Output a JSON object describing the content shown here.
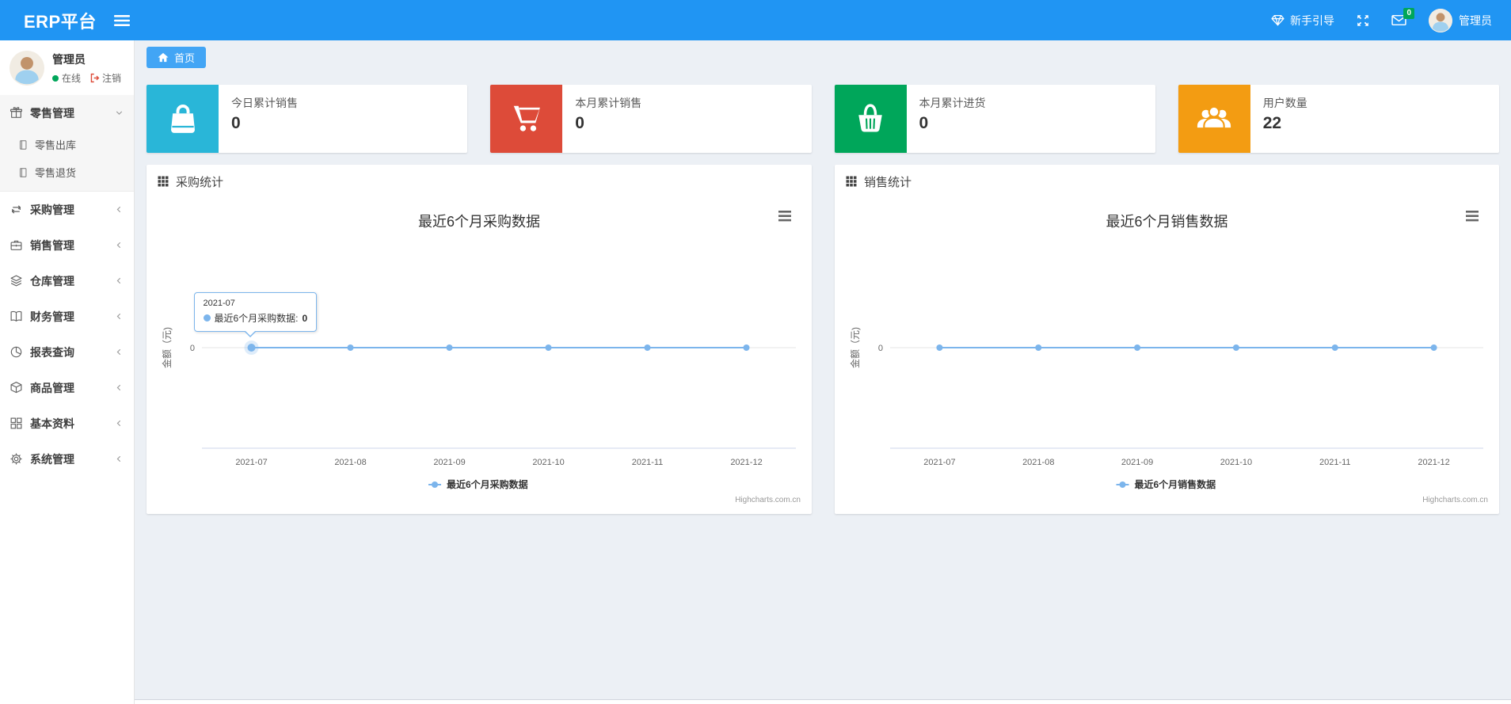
{
  "navbar": {
    "brand": "ERP平台",
    "guide_label": "新手引导",
    "mail_badge": "0",
    "username": "管理员",
    "badge_color": "#00a65a",
    "bg_color": "#2095f3"
  },
  "sidebar": {
    "user": {
      "name": "管理员",
      "status_label": "在线",
      "logout_label": "注销"
    },
    "items": [
      {
        "label": "零售管理",
        "icon": "gift-icon",
        "expanded": true,
        "children": [
          {
            "label": "零售出库",
            "icon": "notebook-icon"
          },
          {
            "label": "零售退货",
            "icon": "notebook-icon"
          }
        ]
      },
      {
        "label": "采购管理",
        "icon": "repeat-icon"
      },
      {
        "label": "销售管理",
        "icon": "briefcase-icon"
      },
      {
        "label": "仓库管理",
        "icon": "layers-icon"
      },
      {
        "label": "财务管理",
        "icon": "open-book-icon"
      },
      {
        "label": "报表查询",
        "icon": "pie-chart-icon"
      },
      {
        "label": "商品管理",
        "icon": "cube-icon"
      },
      {
        "label": "基本资料",
        "icon": "grid-icon"
      },
      {
        "label": "系统管理",
        "icon": "gear-icon"
      }
    ]
  },
  "breadcrumb": {
    "home_label": "首页"
  },
  "stat_cards": [
    {
      "label": "今日累计销售",
      "value": "0",
      "color": "#29b6d8",
      "icon": "shopping-bag-icon"
    },
    {
      "label": "本月累计销售",
      "value": "0",
      "color": "#dd4b39",
      "icon": "shopping-cart-icon"
    },
    {
      "label": "本月累计进货",
      "value": "0",
      "color": "#00a65a",
      "icon": "shopping-basket-icon"
    },
    {
      "label": "用户数量",
      "value": "22",
      "color": "#f39c12",
      "icon": "users-icon"
    }
  ],
  "panels": [
    {
      "header": "采购统计"
    },
    {
      "header": "销售统计"
    }
  ],
  "chart_data": [
    {
      "type": "line",
      "title": "最近6个月采购数据",
      "categories": [
        "2021-07",
        "2021-08",
        "2021-09",
        "2021-10",
        "2021-11",
        "2021-12"
      ],
      "series": [
        {
          "name": "最近6个月采购数据",
          "values": [
            0,
            0,
            0,
            0,
            0,
            0
          ]
        }
      ],
      "ylabel": "金额（元)",
      "ytick_labels": [
        "0"
      ],
      "ylim": [
        -1,
        1
      ],
      "grid": false,
      "legend_position": "bottom",
      "line_color": "#7cb5ec",
      "credits": "Highcharts.com.cn",
      "tooltip": {
        "visible": true,
        "point_index": 0,
        "title": "2021-07",
        "series_text": "最近6个月采购数据:",
        "value": "0"
      }
    },
    {
      "type": "line",
      "title": "最近6个月销售数据",
      "categories": [
        "2021-07",
        "2021-08",
        "2021-09",
        "2021-10",
        "2021-11",
        "2021-12"
      ],
      "series": [
        {
          "name": "最近6个月销售数据",
          "values": [
            0,
            0,
            0,
            0,
            0,
            0
          ]
        }
      ],
      "ylabel": "金额（元)",
      "ytick_labels": [
        "0"
      ],
      "ylim": [
        -1,
        1
      ],
      "grid": false,
      "legend_position": "bottom",
      "line_color": "#7cb5ec",
      "credits": "Highcharts.com.cn",
      "tooltip": {
        "visible": false
      }
    }
  ]
}
